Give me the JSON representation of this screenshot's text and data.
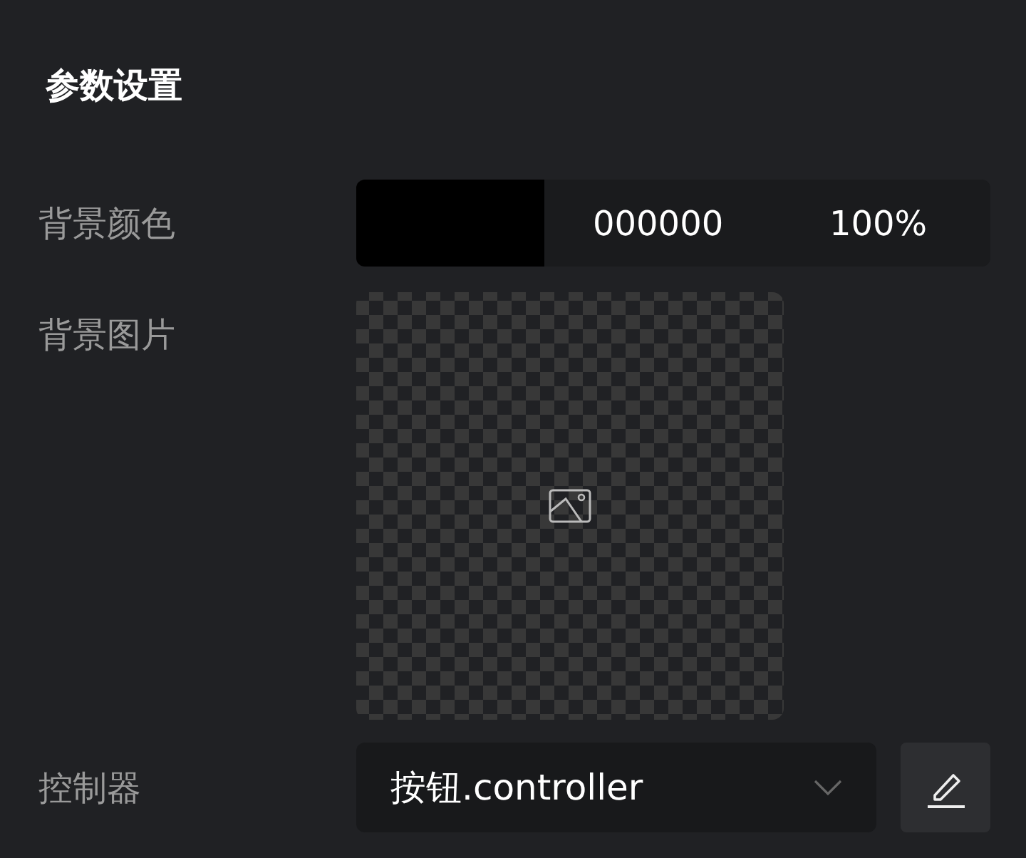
{
  "title": "参数设置",
  "fields": [
    {
      "kind": "color",
      "label": "背景颜色",
      "color": "#000000",
      "hex": "000000",
      "opacity": "100%"
    },
    {
      "kind": "image",
      "label": "背景图片"
    },
    {
      "kind": "select",
      "label": "控制器",
      "value": "按钮.controller"
    }
  ]
}
